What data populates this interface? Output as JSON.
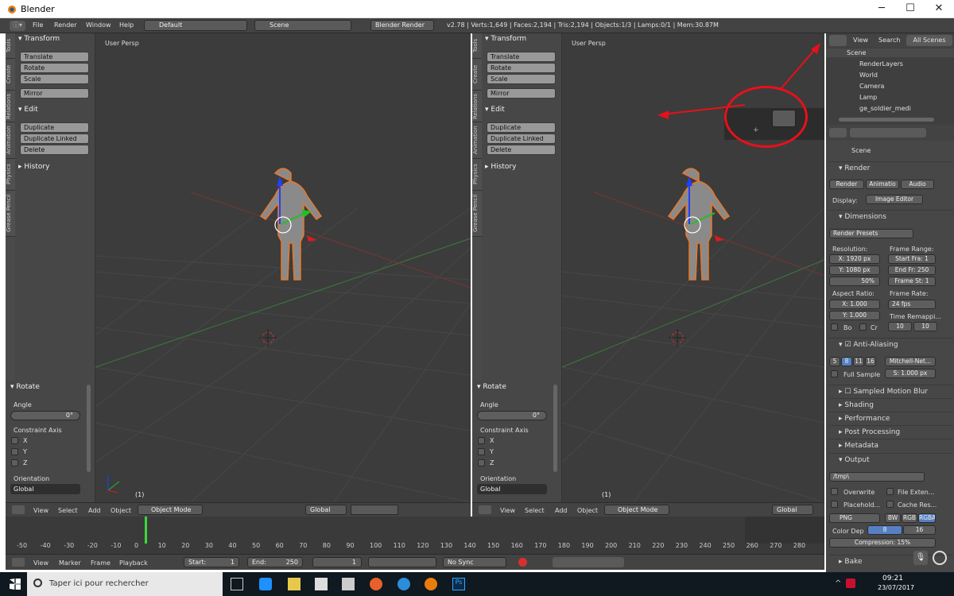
{
  "window": {
    "title": "Blender",
    "minimize": "─",
    "maximize": "☐",
    "close": "✕"
  },
  "menubar": {
    "items": [
      "File",
      "Render",
      "Window",
      "Help"
    ],
    "layout": "Default",
    "scene": "Scene",
    "engine": "Blender Render",
    "stats": "v2.78 | Verts:1,649 | Faces:2,194 | Tris:2,194 | Objects:1/3 | Lamps:0/1 | Mem:30.87M"
  },
  "tool_tabs": [
    "Tools",
    "Create",
    "Relations",
    "Animation",
    "Physics",
    "Grease Pencil"
  ],
  "tool_panel": {
    "transform": "Transform",
    "buttons1": [
      "Translate",
      "Rotate",
      "Scale"
    ],
    "mirror": "Mirror",
    "edit": "Edit",
    "buttons2": [
      "Duplicate",
      "Duplicate Linked",
      "Delete"
    ],
    "history": "History"
  },
  "operator_panel": {
    "title": "Rotate",
    "angle_label": "Angle",
    "angle_value": "0°",
    "constraint_label": "Constraint Axis",
    "axes": [
      "X",
      "Y",
      "Z"
    ],
    "orientation_label": "Orientation",
    "orientation_value": "Global"
  },
  "viewport": {
    "label": "User Persp",
    "frame": "(1)"
  },
  "view_header": {
    "items": [
      "View",
      "Select",
      "Add",
      "Object"
    ],
    "mode": "Object Mode",
    "orientation": "Global"
  },
  "outliner": {
    "tabs": [
      "View",
      "Search",
      "All Scenes"
    ],
    "items": [
      "Scene",
      "RenderLayers",
      "World",
      "Camera",
      "Lamp",
      "ge_soldier_medi"
    ]
  },
  "properties": {
    "scene": "Scene",
    "render": {
      "header": "Render",
      "buttons": [
        "Render",
        "Animatio",
        "Audio"
      ],
      "display_label": "Display:",
      "display_value": "Image Editor"
    },
    "dimensions": {
      "header": "Dimensions",
      "presets": "Render Presets",
      "resolution_label": "Resolution:",
      "res_x": "X: 1920 px",
      "res_y": "Y: 1080 px",
      "res_pct": "50%",
      "frame_range_label": "Frame Range:",
      "start": "Start Fra: 1",
      "end": "End Fr: 250",
      "step": "Frame St: 1",
      "aspect_label": "Aspect Ratio:",
      "asp_x": "X: 1.000",
      "asp_y": "Y: 1.000",
      "frame_rate_label": "Frame Rate:",
      "fps": "24 fps",
      "remap_label": "Time Remappi...",
      "remap_old": "10",
      "remap_new": "10",
      "border": "Bo",
      "crop": "Cr"
    },
    "aa": {
      "header": "Anti-Aliasing",
      "samples": [
        "5",
        "8",
        "11",
        "16"
      ],
      "filter": "Mitchell-Net...",
      "full_sample": "Full Sample",
      "size": "S: 1.000 px"
    },
    "collapsed": [
      "Sampled Motion Blur",
      "Shading",
      "Performance",
      "Post Processing",
      "Metadata"
    ],
    "output": {
      "header": "Output",
      "path": "/tmp\\",
      "overwrite": "Overwrite",
      "file_ext": "File Exten...",
      "placeholders": "Placehold...",
      "cache": "Cache Res...",
      "format": "PNG",
      "color_modes": [
        "BW",
        "RGB",
        "RGBA"
      ],
      "depth_label": "Color Dep",
      "depths": [
        "8",
        "16"
      ],
      "compression": "Compression:",
      "compression_value": "15%"
    },
    "bake": "Bake"
  },
  "timeline": {
    "ticks": [
      "-50",
      "-40",
      "-30",
      "-20",
      "-10",
      "0",
      "10",
      "20",
      "30",
      "40",
      "50",
      "60",
      "70",
      "80",
      "90",
      "100",
      "110",
      "120",
      "130",
      "140",
      "150",
      "160",
      "170",
      "180",
      "190",
      "200",
      "210",
      "220",
      "230",
      "240",
      "250",
      "260",
      "270",
      "280"
    ],
    "menu": [
      "View",
      "Marker",
      "Frame",
      "Playback"
    ],
    "start": "Start:",
    "start_val": "1",
    "end": "End:",
    "end_val": "250",
    "current": "1",
    "sync": "No Sync"
  },
  "taskbar": {
    "search": "Taper ici pour rechercher",
    "time": "09:21",
    "date": "23/07/2017"
  },
  "colors": {
    "annotation": "#e8101a",
    "selection": "#e8782a",
    "bg": "#3c3c3c"
  }
}
